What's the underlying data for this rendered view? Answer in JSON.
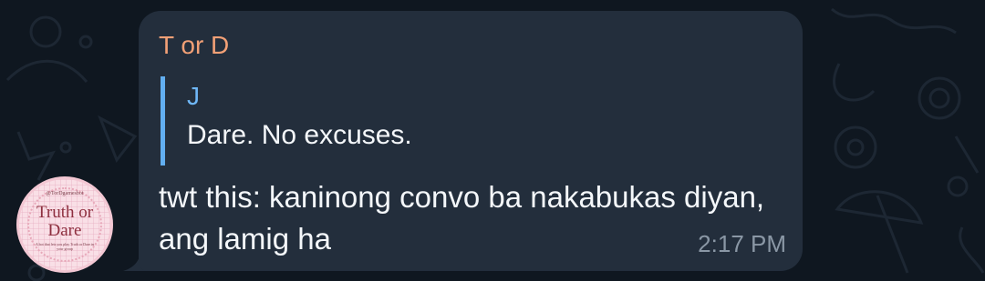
{
  "avatar": {
    "handle": "@TorDgamesbot",
    "title_line1": "Truth or",
    "title_line2": "Dare",
    "blurb": "A bot that lets you play Truth or Dare in your group"
  },
  "message": {
    "sender": "T or D",
    "reply": {
      "author": "J",
      "text": "Dare. No excuses."
    },
    "text": "twt this: kaninong convo ba nakabukas diyan, ang lamig ha",
    "time": "2:17 PM"
  },
  "colors": {
    "background": "#0f1720",
    "bubble": "#232e3c",
    "sender_name": "#f2a076",
    "reply_accent": "#62aef0",
    "reply_author": "#6fb7f7",
    "text": "#f4f7fa",
    "timestamp": "#8a97a5"
  }
}
